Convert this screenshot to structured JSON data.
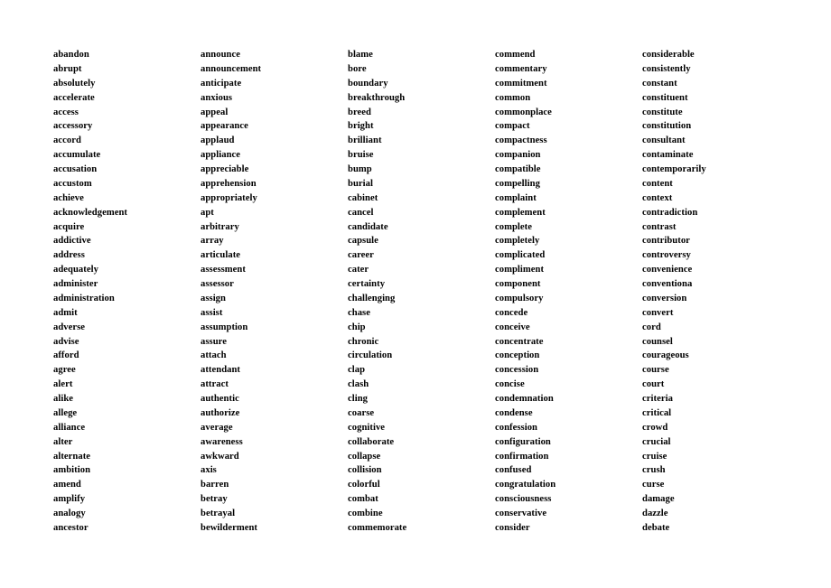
{
  "page": {
    "type": "word-list",
    "background_color": "#ffffff",
    "text_color": "#000000",
    "column_count": 5,
    "rows_per_column": 34
  },
  "columns": [
    {
      "index": 1,
      "words": [
        "abandon",
        "abrupt",
        "absolutely",
        "accelerate",
        "access",
        "accessory",
        "accord",
        "accumulate",
        "accusation",
        "accustom",
        "achieve",
        "acknowledgement",
        "acquire",
        "addictive",
        "address",
        "adequately",
        "administer",
        "administration",
        "admit",
        "adverse",
        "advise",
        "afford",
        "agree",
        "alert",
        "alike",
        "allege",
        "alliance",
        "alter",
        "alternate",
        "ambition",
        "amend",
        "amplify",
        "analogy",
        "ancestor"
      ]
    },
    {
      "index": 2,
      "words": [
        "announce",
        "announcement",
        "anticipate",
        "anxious",
        "appeal",
        "appearance",
        "applaud",
        "appliance",
        "appreciable",
        "apprehension",
        "appropriately",
        "apt",
        "arbitrary",
        "array",
        "articulate",
        "assessment",
        "assessor",
        "assign",
        "assist",
        "assumption",
        "assure",
        "attach",
        "attendant",
        "attract",
        "authentic",
        "authorize",
        "average",
        "awareness",
        "awkward",
        "axis",
        "barren",
        "betray",
        "betrayal",
        "bewilderment"
      ]
    },
    {
      "index": 3,
      "words": [
        "blame",
        "bore",
        "boundary",
        "breakthrough",
        "breed",
        "bright",
        "brilliant",
        "bruise",
        "bump",
        "burial",
        "cabinet",
        "cancel",
        "candidate",
        "capsule",
        "career",
        "cater",
        "certainty",
        "challenging",
        "chase",
        "chip",
        "chronic",
        "circulation",
        "clap",
        "clash",
        "cling",
        "coarse",
        "cognitive",
        "collaborate",
        "collapse",
        "collision",
        "colorful",
        "combat",
        "combine",
        "commemorate"
      ]
    },
    {
      "index": 4,
      "words": [
        "commend",
        "commentary",
        "commitment",
        "common",
        "commonplace",
        "compact",
        "compactness",
        "companion",
        "compatible",
        "compelling",
        "complaint",
        "complement",
        "complete",
        "completely",
        "complicated",
        "compliment",
        "component",
        "compulsory",
        "concede",
        "conceive",
        "concentrate",
        "conception",
        "concession",
        "concise",
        "condemnation",
        "condense",
        "confession",
        "configuration",
        "confirmation",
        "confused",
        "congratulation",
        "consciousness",
        "conservative",
        "consider"
      ]
    },
    {
      "index": 5,
      "words": [
        "considerable",
        "consistently",
        "constant",
        "constituent",
        "constitute",
        "constitution",
        "consultant",
        "contaminate",
        "contemporarily",
        "content",
        "context",
        "contradiction",
        "contrast",
        "contributor",
        "controversy",
        "convenience",
        "conventiona",
        "conversion",
        "convert",
        "cord",
        "counsel",
        "courageous",
        "course",
        "court",
        "criteria",
        "critical",
        "crowd",
        "crucial",
        "cruise",
        "crush",
        "curse",
        "damage",
        "dazzle",
        "debate"
      ]
    }
  ]
}
